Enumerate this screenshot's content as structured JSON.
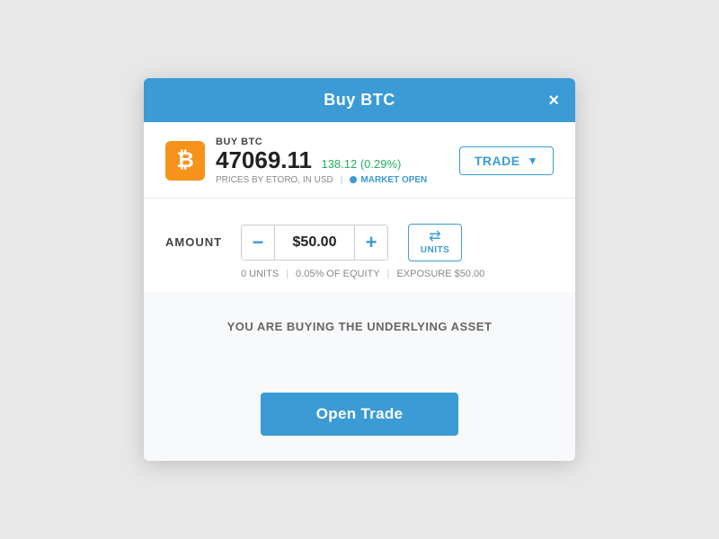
{
  "modal": {
    "title": "Buy BTC",
    "close_label": "×"
  },
  "asset": {
    "label": "BUY BTC",
    "price": "47069.11",
    "change": "138.12 (0.29%)",
    "meta": "PRICES BY ETORO, IN USD",
    "market_status": "MARKET OPEN",
    "btc_symbol": "₿"
  },
  "trade_dropdown": {
    "label": "TRADE",
    "arrow": "▼"
  },
  "amount": {
    "label": "AMOUNT",
    "value": "$50.00",
    "minus": "−",
    "plus": "+"
  },
  "units_button": {
    "icon": "⇄",
    "label": "UNITS"
  },
  "amount_info": {
    "units": "0 UNITS",
    "equity": "0.05% OF EQUITY",
    "exposure": "EXPOSURE $50.00"
  },
  "underlying": {
    "text": "YOU ARE BUYING THE UNDERLYING ASSET"
  },
  "open_trade": {
    "label": "Open Trade"
  }
}
